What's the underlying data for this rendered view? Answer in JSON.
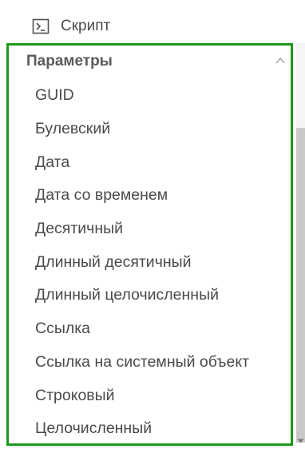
{
  "script_item": {
    "label": "Скрипт",
    "icon": "terminal-icon"
  },
  "parameters": {
    "title": "Параметры",
    "collapse_icon": "chevron-up-icon",
    "items": [
      {
        "label": "GUID"
      },
      {
        "label": "Булевский"
      },
      {
        "label": "Дата"
      },
      {
        "label": "Дата со временем"
      },
      {
        "label": "Десятичный"
      },
      {
        "label": "Длинный десятичный"
      },
      {
        "label": "Длинный целочисленный"
      },
      {
        "label": "Ссылка"
      },
      {
        "label": "Ссылка на системный объект"
      },
      {
        "label": "Строковый"
      },
      {
        "label": "Целочисленный"
      }
    ]
  },
  "colors": {
    "highlight_border": "#1c9a1c",
    "text": "#4a4a4a",
    "scrollbar_thumb": "#c9c9c9"
  }
}
